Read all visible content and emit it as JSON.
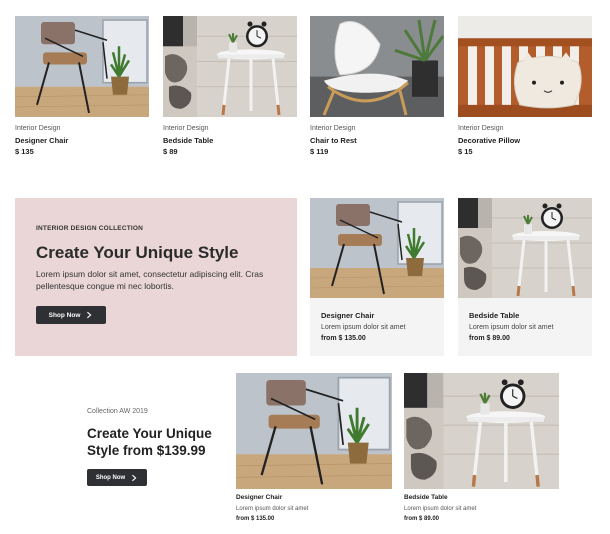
{
  "products": [
    {
      "category": "Interior Design",
      "name": "Designer Chair",
      "price": "$ 135",
      "image": "chair-photo"
    },
    {
      "category": "Interior Design",
      "name": "Bedside Table",
      "price": "$ 89",
      "image": "bedside-table-photo"
    },
    {
      "category": "Interior Design",
      "name": "Chair to Rest",
      "price": "$ 119",
      "image": "white-chair-photo"
    },
    {
      "category": "Interior Design",
      "name": "Decorative Pillow",
      "price": "$ 15",
      "image": "pillow-photo"
    }
  ],
  "banner": {
    "eyebrow": "INTERIOR DESIGN COLLECTION",
    "headline": "Create Your Unique Style",
    "description": "Lorem ipsum dolor sit amet, consectetur adipiscing elit. Cras pellentesque congue mi nec lobortis.",
    "button_label": "Shop Now",
    "background": "#ead6d7"
  },
  "feature_cards": [
    {
      "title": "Designer Chair",
      "description": "Lorem ipsum dolor sit amet",
      "price": "from $ 135.00"
    },
    {
      "title": "Bedside Table",
      "description": "Lorem ipsum dolor sit amet",
      "price": "from $ 89.00"
    }
  ],
  "collection": {
    "label": "Collection AW 2019",
    "headline": "Create Your Unique Style from $139.99",
    "button_label": "Shop Now"
  },
  "collection_items": [
    {
      "title": "Designer Chair",
      "description": "Lorem ipsum dolor sit amet",
      "price": "from $ 135.00"
    },
    {
      "title": "Bedside Table",
      "description": "Lorem ipsum dolor sit amet",
      "price": "from $ 89.00"
    }
  ],
  "colors": {
    "button": "#2f3033",
    "card_bg": "#f4f4f4"
  }
}
